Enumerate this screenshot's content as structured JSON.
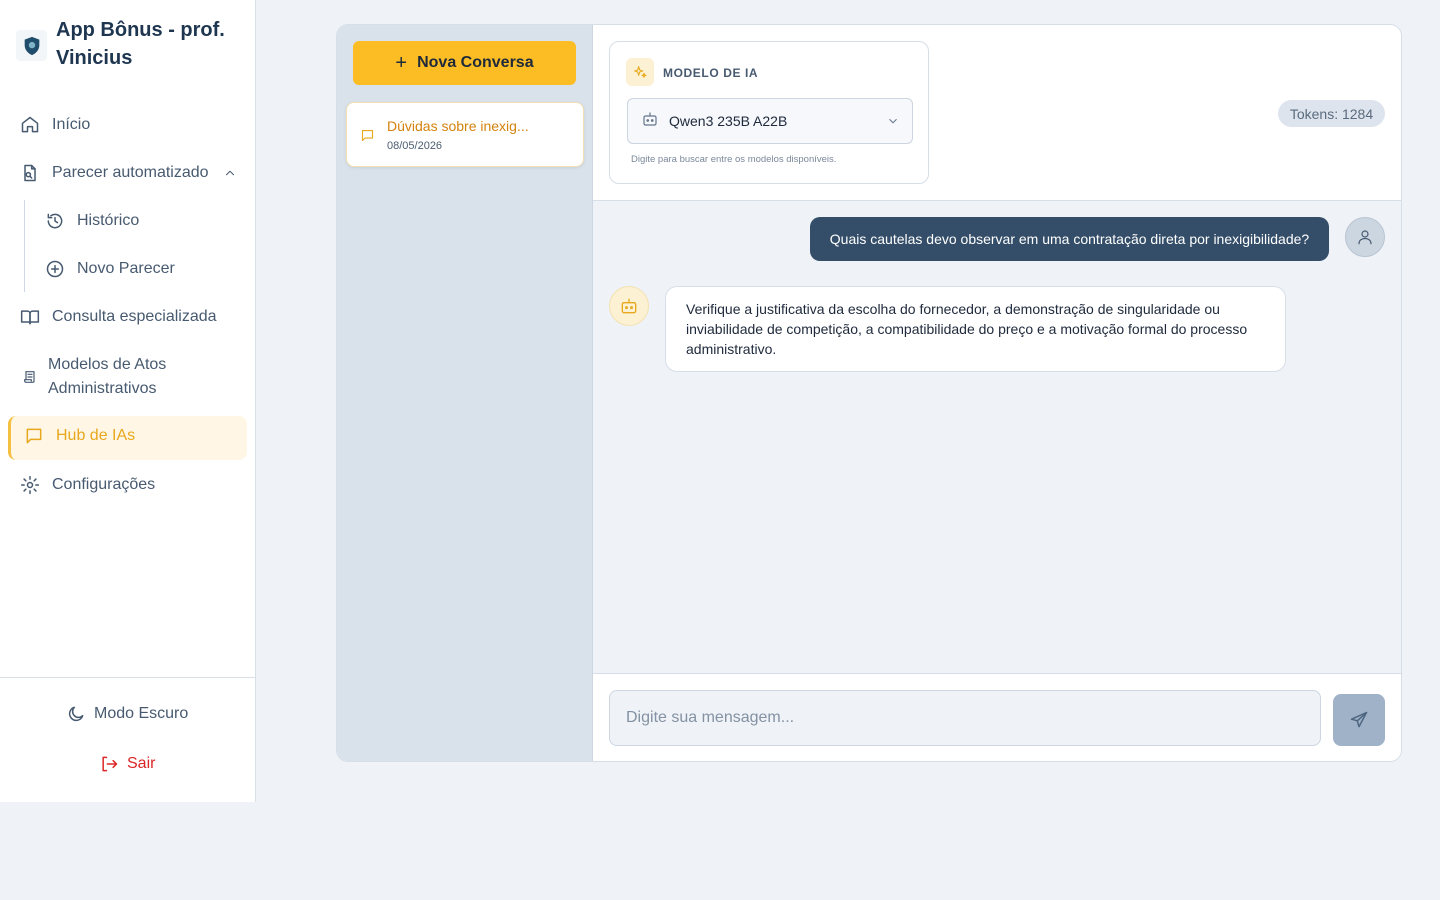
{
  "brand": {
    "title": "App Bônus - prof. Vinicius"
  },
  "nav": {
    "inicio": "Início",
    "parecer": "Parecer automatizado",
    "historico": "Histórico",
    "novo_parecer": "Novo Parecer",
    "consulta": "Consulta especializada",
    "modelos_atos": "Modelos de Atos Administrativos",
    "hub": "Hub de IAs",
    "config": "Configurações"
  },
  "footer": {
    "dark_mode": "Modo Escuro",
    "logout": "Sair"
  },
  "conversations": {
    "new_label": "Nova Conversa",
    "items": [
      {
        "title": "Dúvidas sobre inexig...",
        "date": "08/05/2026"
      }
    ]
  },
  "model": {
    "label": "MODELO DE IA",
    "selected": "Qwen3 235B A22B",
    "hint": "Digite para buscar entre os modelos disponíveis."
  },
  "tokens": "Tokens: 1284",
  "messages": {
    "user": "Quais cautelas devo observar em uma contratação direta por inexigibilidade?",
    "bot": "Verifique a justificativa da escolha do fornecedor, a demonstração de singularidade ou inviabilidade de competição, a compatibilidade do preço e a motivação formal do processo administrativo."
  },
  "composer": {
    "placeholder": "Digite sua mensagem..."
  },
  "colors": {
    "accent": "#fbbd23",
    "user_bubble": "#344e69",
    "logout": "#dc2626"
  }
}
